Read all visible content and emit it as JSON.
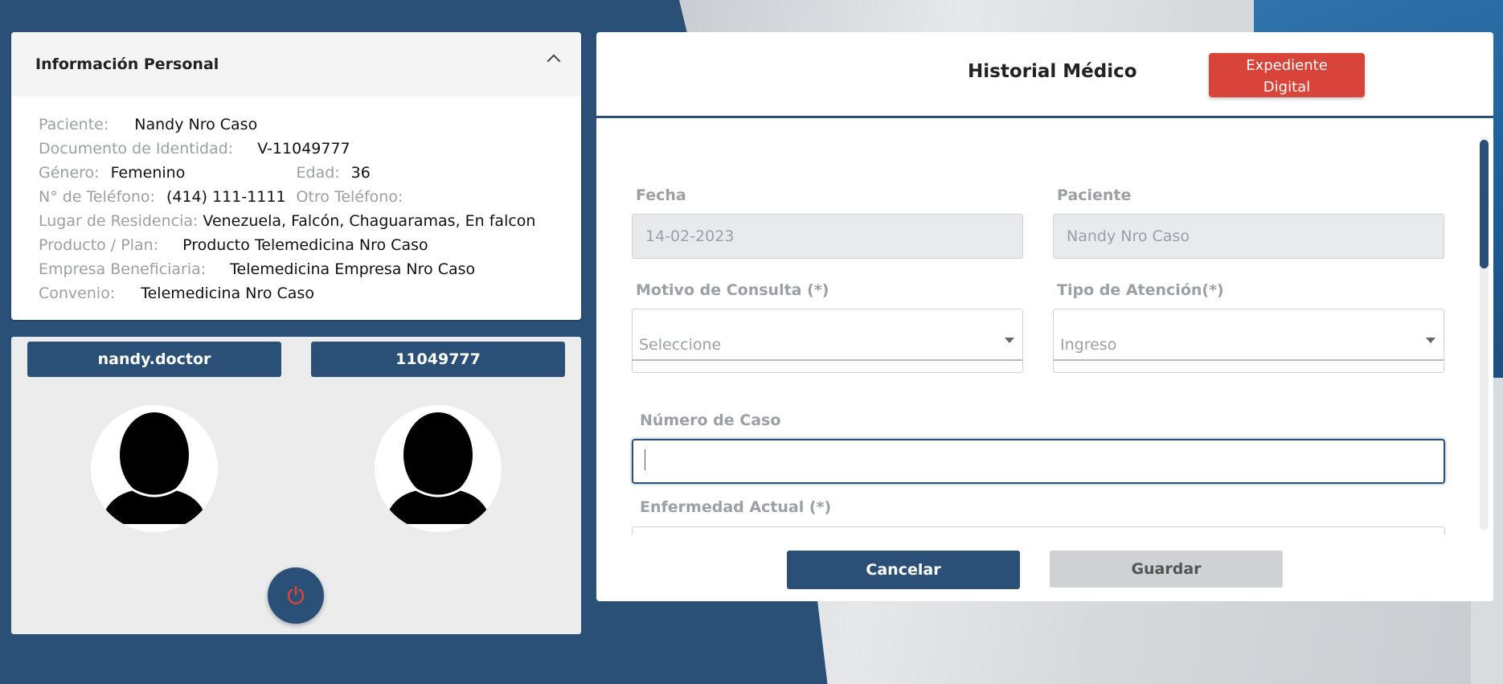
{
  "personal_info": {
    "title": "Información Personal",
    "patient_label": "Paciente:",
    "patient_value": "Nandy Nro Caso",
    "document_label": "Documento de Identidad:",
    "document_value": "V-11049777",
    "gender_label": "Género:",
    "gender_value": "Femenino",
    "age_label": "Edad:",
    "age_value": "36",
    "phone_label": "N° de Teléfono:",
    "phone_value": "(414) 111-1111",
    "other_phone_label": "Otro Teléfono:",
    "other_phone_value": "",
    "residence_label": "Lugar de Residencia:",
    "residence_value": "Venezuela, Falcón, Chaguaramas, En falcon",
    "product_label": "Producto / Plan:",
    "product_value": "Producto Telemedicina Nro Caso",
    "company_label": "Empresa Beneficiaria:",
    "company_value": "Telemedicina Empresa Nro Caso",
    "agreement_label": "Convenio:",
    "agreement_value": "Telemedicina Nro Caso"
  },
  "users": {
    "doctor_name": "nandy.doctor",
    "patient_id": "11049777"
  },
  "history": {
    "title": "Historial Médico",
    "digital_record_button": "Expediente Digital",
    "date_label": "Fecha",
    "date_value": "14-02-2023",
    "patient_label": "Paciente",
    "patient_value": "Nandy Nro Caso",
    "reason_label": "Motivo de Consulta (*)",
    "reason_value": "Seleccione",
    "attention_label": "Tipo de Atención(*)",
    "attention_value": "Ingreso",
    "case_number_label": "Número de Caso",
    "case_number_value": "",
    "current_illness_label": "Enfermedad Actual (*)",
    "cancel_button": "Cancelar",
    "save_button": "Guardar"
  },
  "colors": {
    "primary": "#2b5078",
    "danger": "#d9443a",
    "disabled": "#cfd1d4"
  }
}
